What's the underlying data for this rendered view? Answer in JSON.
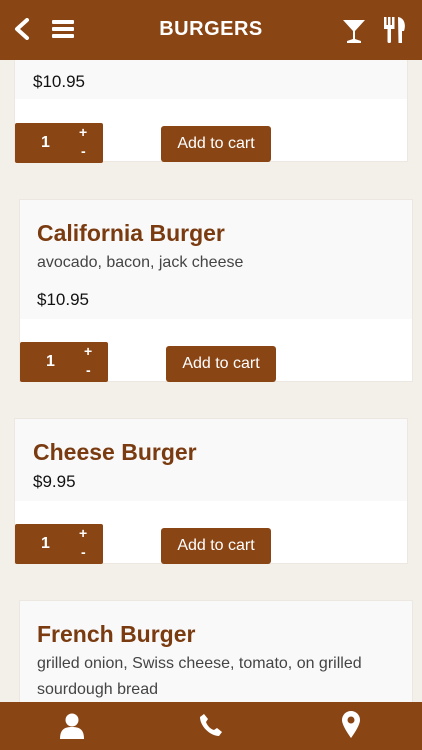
{
  "header": {
    "title": "BURGERS",
    "back_icon": "back-chevron-icon",
    "menu_icon": "hamburger-menu-icon",
    "drinks_icon": "cocktail-glass-icon",
    "food_icon": "fork-knife-icon"
  },
  "items": [
    {
      "name": "",
      "description": "",
      "price": "$10.95",
      "quantity": "1",
      "plus": "+",
      "minus": "-",
      "add_label": "Add to cart"
    },
    {
      "name": "California Burger",
      "description": "avocado, bacon, jack cheese",
      "price": "$10.95",
      "quantity": "1",
      "plus": "+",
      "minus": "-",
      "add_label": "Add to cart"
    },
    {
      "name": "Cheese Burger",
      "description": "",
      "price": "$9.95",
      "quantity": "1",
      "plus": "+",
      "minus": "-",
      "add_label": "Add to cart"
    },
    {
      "name": "French Burger",
      "description": "grilled onion, Swiss cheese, tomato, on grilled sourdough bread"
    }
  ],
  "footer": {
    "account_icon": "user-icon",
    "phone_icon": "phone-icon",
    "location_icon": "map-pin-icon"
  },
  "colors": {
    "brand": "#8a4514",
    "title_text": "#7a3b10",
    "background": "#f3efe9"
  }
}
